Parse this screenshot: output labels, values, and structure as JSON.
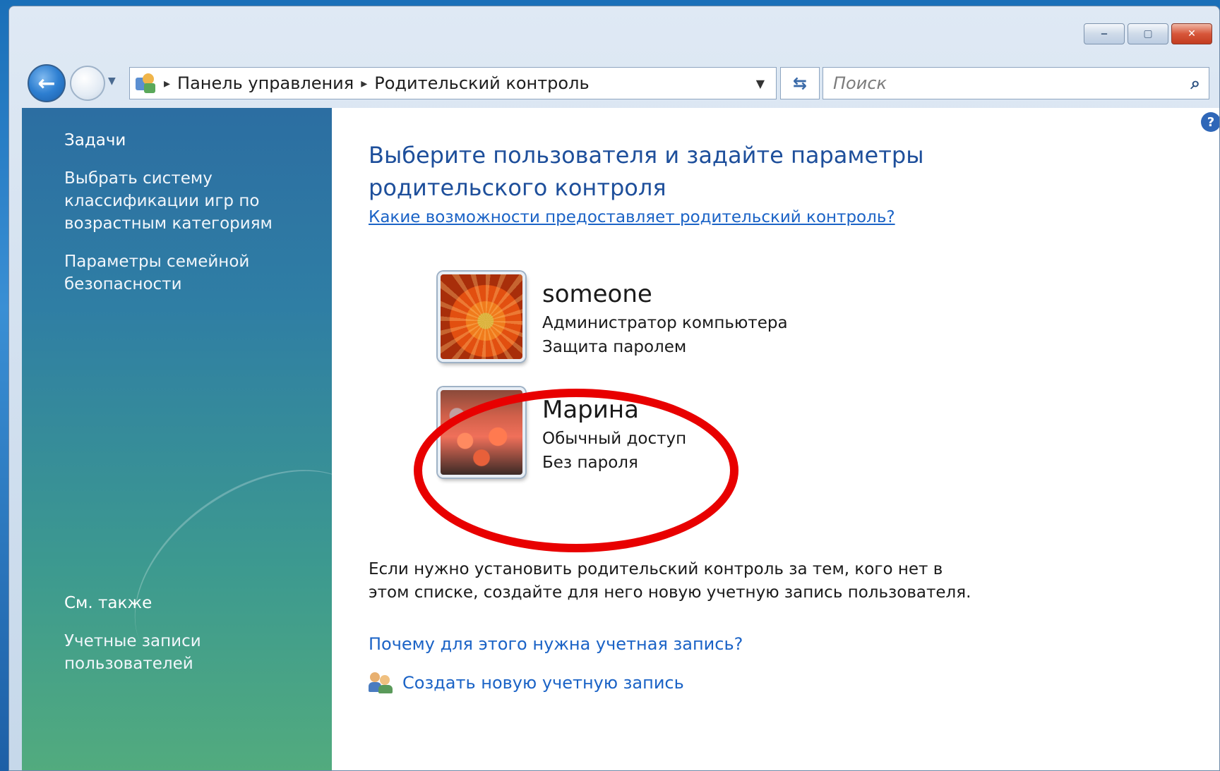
{
  "window": {
    "controls": {
      "minimize": "‒",
      "maximize": "▢",
      "close": "✕"
    }
  },
  "address": {
    "crumbs": [
      "Панель управления",
      "Родительский контроль"
    ],
    "search_placeholder": "Поиск"
  },
  "sidebar": {
    "tasks_heading": "Задачи",
    "tasks": [
      "Выбрать систему классификации игр по возрастным категориям",
      "Параметры семейной безопасности"
    ],
    "see_also_heading": "См. также",
    "see_also": [
      "Учетные записи пользователей"
    ]
  },
  "main": {
    "title": "Выберите пользователя и задайте параметры родительского контроля",
    "info_link": "Какие возможности предоставляет родительский контроль?",
    "users": [
      {
        "name": "someone",
        "role": "Администратор компьютера",
        "password": "Защита паролем",
        "avatar": "orange-flower"
      },
      {
        "name": "Марина",
        "role": "Обычный доступ",
        "password": "Без пароля",
        "avatar": "red-blossoms"
      }
    ],
    "note": "Если нужно установить родительский контроль за тем, кого нет в этом списке, создайте для него новую учетную запись пользователя.",
    "why_link": "Почему для этого нужна учетная запись?",
    "create_link": "Создать новую учетную запись"
  },
  "colors": {
    "highlight": "#e80000",
    "link": "#1b63c6",
    "title": "#1e4f9b"
  }
}
